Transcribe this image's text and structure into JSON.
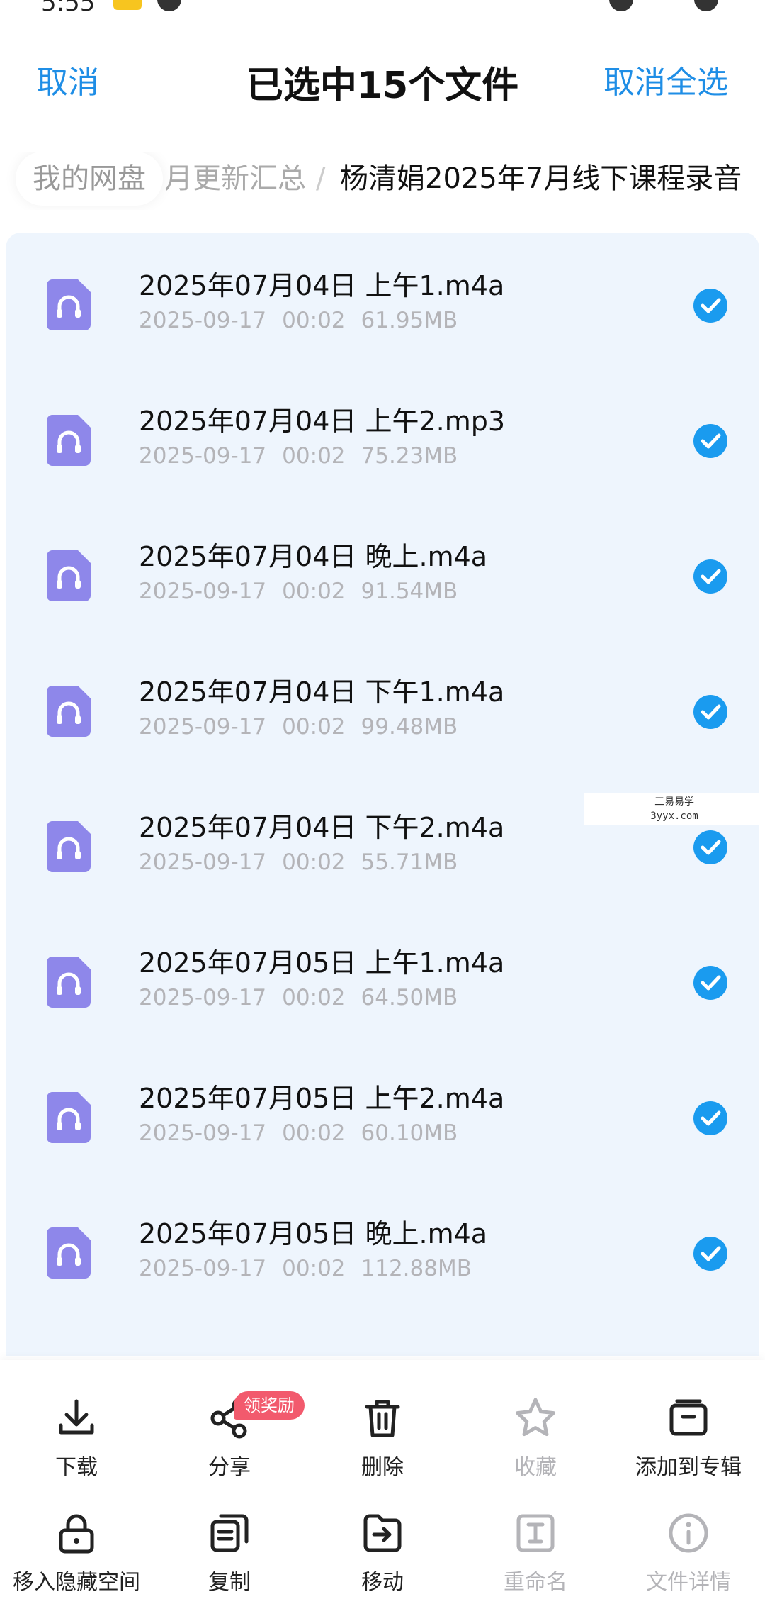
{
  "status_bar": {
    "time": "5:55"
  },
  "header": {
    "cancel_label": "取消",
    "title": "已选中15个文件",
    "deselect_all_label": "取消全选"
  },
  "breadcrumb": {
    "root": "我的网盘",
    "middle": "月更新汇总",
    "separator": "/",
    "current": "杨清娟2025年7月线下课程录音"
  },
  "files": [
    {
      "name": "2025年07月04日 上午1.m4a",
      "date": "2025-09-17",
      "time": "00:02",
      "size": "61.95MB",
      "selected": true
    },
    {
      "name": "2025年07月04日 上午2.mp3",
      "date": "2025-09-17",
      "time": "00:02",
      "size": "75.23MB",
      "selected": true
    },
    {
      "name": "2025年07月04日 晚上.m4a",
      "date": "2025-09-17",
      "time": "00:02",
      "size": "91.54MB",
      "selected": true
    },
    {
      "name": "2025年07月04日 下午1.m4a",
      "date": "2025-09-17",
      "time": "00:02",
      "size": "99.48MB",
      "selected": true
    },
    {
      "name": "2025年07月04日 下午2.m4a",
      "date": "2025-09-17",
      "time": "00:02",
      "size": "55.71MB",
      "selected": true
    },
    {
      "name": "2025年07月05日 上午1.m4a",
      "date": "2025-09-17",
      "time": "00:02",
      "size": "64.50MB",
      "selected": true
    },
    {
      "name": "2025年07月05日 上午2.m4a",
      "date": "2025-09-17",
      "time": "00:02",
      "size": "60.10MB",
      "selected": true
    },
    {
      "name": "2025年07月05日 晚上.m4a",
      "date": "2025-09-17",
      "time": "00:02",
      "size": "112.88MB",
      "selected": true
    }
  ],
  "watermark": {
    "line1": "三易易学",
    "line2": "3yyx.com"
  },
  "actions": {
    "download": "下载",
    "share": "分享",
    "share_badge": "领奖励",
    "delete": "删除",
    "favorite": "收藏",
    "add_to_album": "添加到专辑",
    "move_to_hidden": "移入隐藏空间",
    "copy": "复制",
    "move": "移动",
    "rename": "重命名",
    "file_details": "文件详情"
  },
  "colors": {
    "accent": "#1f8ee6",
    "check": "#1a9bef",
    "list_bg": "#eef5fd",
    "file_icon": "#8e87ea",
    "badge": "#f25a6d",
    "disabled_text": "#b4b4b8"
  },
  "icons": {
    "file": "audio-file-headphones-icon",
    "check": "check-circle-icon",
    "download": "download-icon",
    "share": "share-icon",
    "delete": "trash-icon",
    "favorite": "star-icon",
    "add_to_album": "album-box-icon",
    "move_to_hidden": "lock-icon",
    "copy": "copy-icon",
    "move": "folder-arrow-icon",
    "rename": "rename-icon",
    "file_details": "info-icon"
  }
}
